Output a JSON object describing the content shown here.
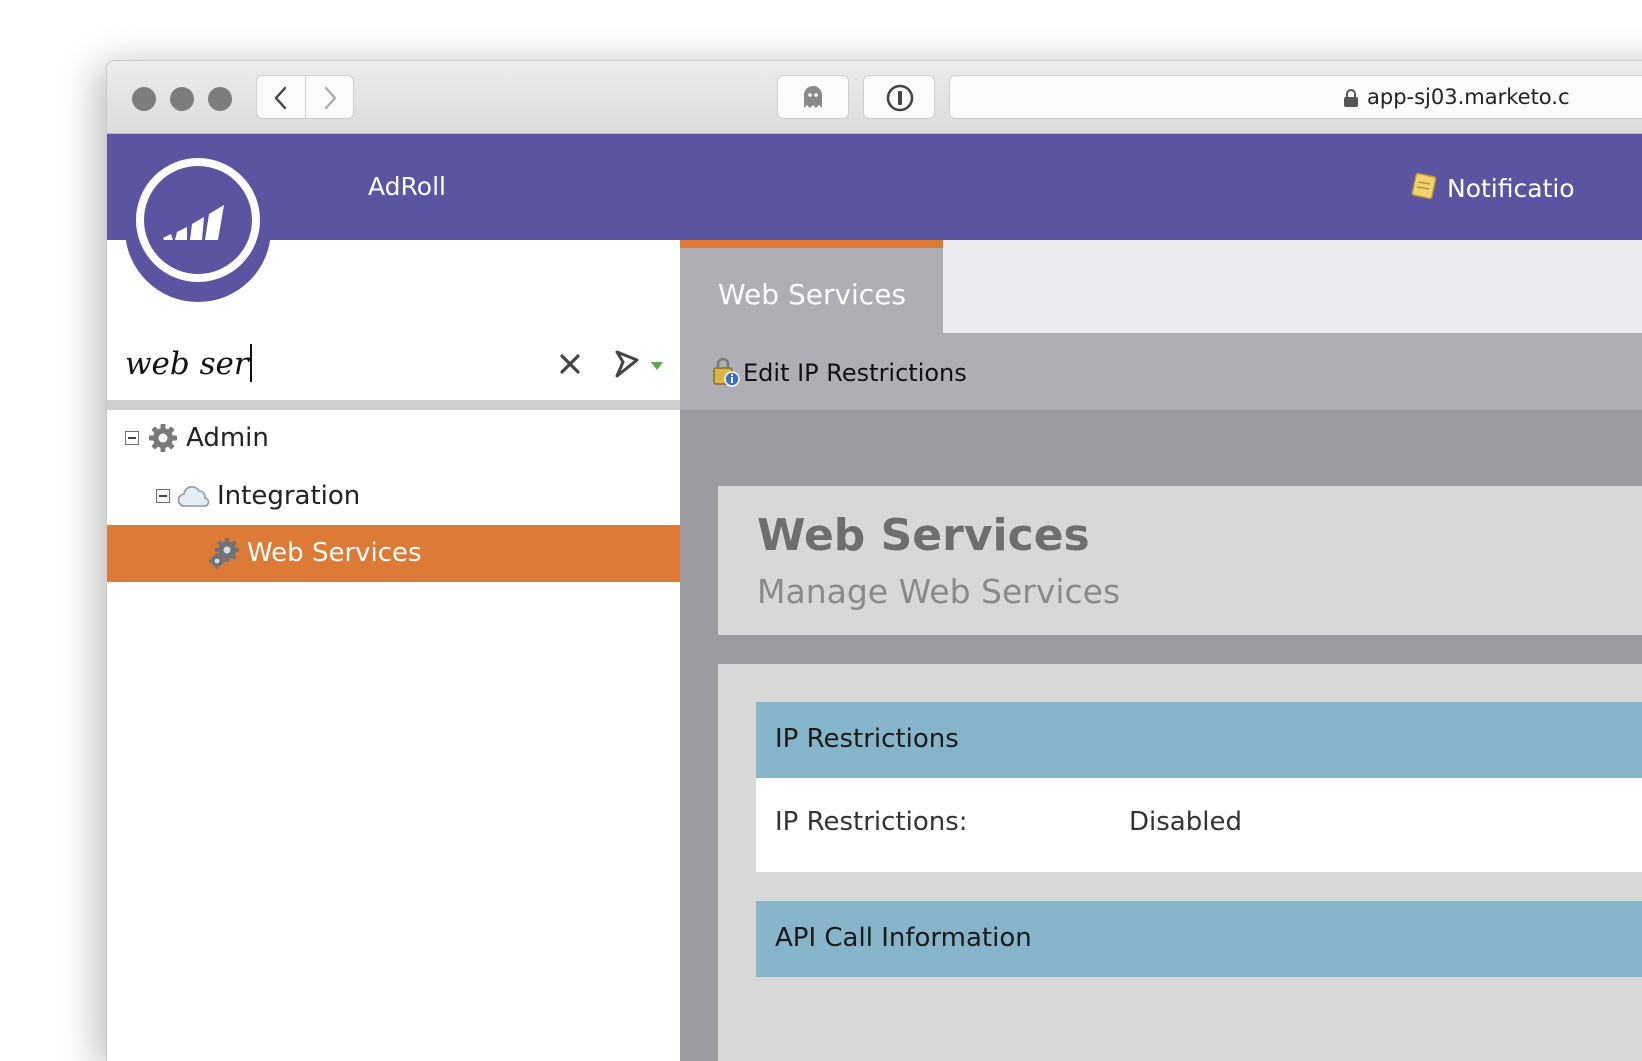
{
  "browser": {
    "url": "app-sj03.marketo.c"
  },
  "header": {
    "org_name": "AdRoll",
    "notifications_label": "Notificatio"
  },
  "search": {
    "query": "web ser"
  },
  "tree": {
    "items": [
      {
        "label": "Admin",
        "icon": "gear-icon",
        "expanded": true
      },
      {
        "label": "Integration",
        "icon": "cloud-icon",
        "expanded": true
      },
      {
        "label": "Web Services",
        "icon": "gears-icon",
        "selected": true
      }
    ]
  },
  "tabs": {
    "active_label": "Web Services"
  },
  "toolbar": {
    "edit_ip_label": "Edit IP Restrictions"
  },
  "page": {
    "title": "Web Services",
    "subtitle": "Manage Web Services"
  },
  "sections": {
    "ip_restrictions": {
      "heading": "IP Restrictions",
      "row_label": "IP Restrictions:",
      "row_value": "Disabled"
    },
    "api_call_info": {
      "heading": "API Call Information"
    }
  },
  "colors": {
    "brand_purple": "#5b54a0",
    "accent_orange": "#dc7a36",
    "section_blue": "#86b4cb"
  }
}
